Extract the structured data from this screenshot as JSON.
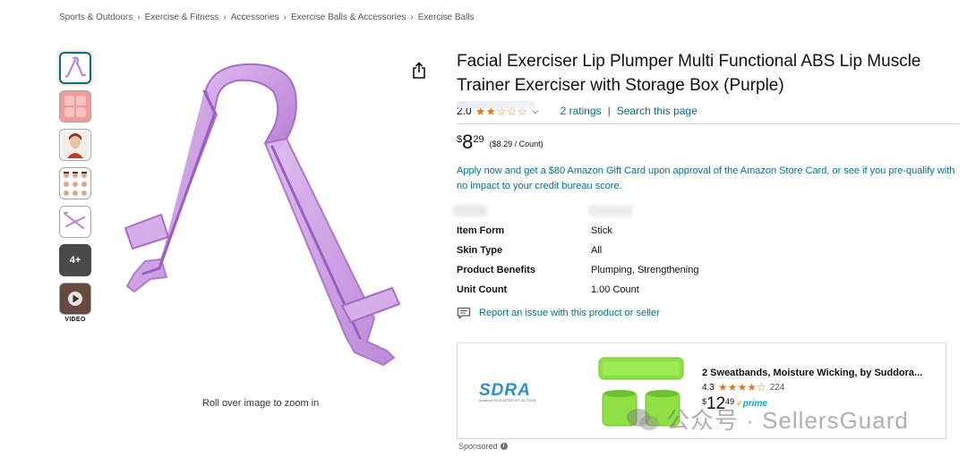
{
  "breadcrumb": {
    "items": [
      "Sports & Outdoors",
      "Exercise & Fitness",
      "Accessories",
      "Exercise Balls & Accessories",
      "Exercise Balls"
    ],
    "separator": "›"
  },
  "gallery": {
    "more_label": "4+",
    "video_label": "VIDEO",
    "zoom_hint": "Roll over image to zoom in"
  },
  "product": {
    "title": "Facial Exerciser Lip Plumper Multi Functional ABS Lip Muscle Trainer Exerciser with Storage Box (Purple)",
    "rating_value": "2.0",
    "rating_stars": 2,
    "ratings_link": "2 ratings",
    "search_link": "Search this page",
    "price_currency": "$",
    "price_whole": "8",
    "price_fraction": "29",
    "price_per_unit": "($8.29 / Count)",
    "promo": "Apply now and get a $80 Amazon Gift Card upon approval of the Amazon Store Card, or see if you pre-qualify with no impact to your credit bureau score.",
    "specs": [
      {
        "label": "Item Form",
        "value": "Stick"
      },
      {
        "label": "Skin Type",
        "value": "All"
      },
      {
        "label": "Product Benefits",
        "value": "Plumping, Strengthening"
      },
      {
        "label": "Unit Count",
        "value": "1.00 Count"
      }
    ],
    "report_link": "Report an issue with this product or seller"
  },
  "ad": {
    "brand": "SDRA",
    "tagline": "suddora  ELEVATED BY ACTION",
    "title": "2 Sweatbands, Moisture Wicking, by Suddora...",
    "rating_value": "4.3",
    "rating_count": "224",
    "price_currency": "$",
    "price_whole": "12",
    "price_fraction": "49",
    "prime_label": "prime",
    "sponsored_label": "Sponsored"
  },
  "watermark": {
    "text": "公众号 · SellersGuard"
  },
  "colors": {
    "link": "#007185",
    "star": "#de7921",
    "product_purple": "#c99ae0",
    "sweatband_green": "#8ee045",
    "prime_blue": "#00a8e1"
  }
}
